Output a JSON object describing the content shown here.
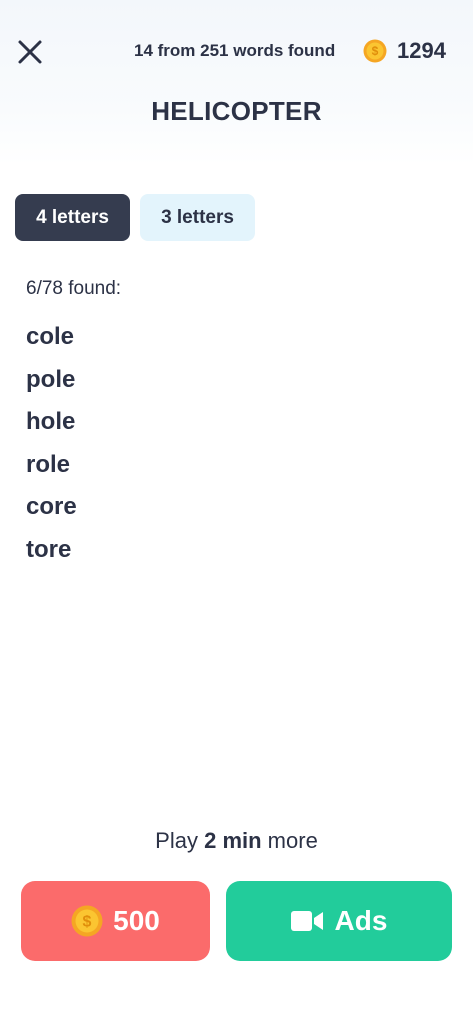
{
  "header": {
    "progress_text": "14 from 251 words found",
    "coin_balance": "1294",
    "icons": [
      "close-icon",
      "coin-icon"
    ]
  },
  "puzzle": {
    "word": "HELICOPTER"
  },
  "tabs": [
    {
      "label": "4 letters",
      "active": true
    },
    {
      "label": "3 letters",
      "active": false
    }
  ],
  "found_list": {
    "count_label": "6/78 found:",
    "words": [
      "cole",
      "pole",
      "hole",
      "role",
      "core",
      "tore"
    ]
  },
  "footer": {
    "play_prefix": "Play ",
    "play_duration": "2 min",
    "play_suffix": " more",
    "coin_button_label": "500",
    "ads_button_label": "Ads",
    "icons": [
      "coin-icon",
      "video-camera-icon"
    ]
  },
  "colors": {
    "dark_text": "#2c3246",
    "active_tab": "#353c4f",
    "inactive_tab": "#e3f4fc",
    "coin_button": "#fb6b6b",
    "ads_button": "#22cc9b",
    "coin_gold": "#f7b52c"
  }
}
